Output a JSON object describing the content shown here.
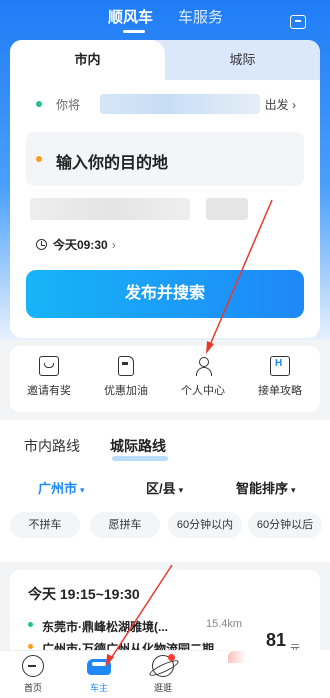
{
  "header": {
    "tabs": [
      {
        "label": "顺风车",
        "active": true
      },
      {
        "label": "车服务",
        "active": false
      }
    ],
    "message_icon": "message-icon"
  },
  "booking": {
    "mode_tabs": [
      {
        "label": "市内",
        "active": true
      },
      {
        "label": "城际",
        "active": false
      }
    ],
    "from_label": "你将",
    "depart_label": "出发 ›",
    "destination_placeholder": "输入你的目的地",
    "time_label": "今天09:30",
    "time_chevron": "›",
    "publish_button": "发布并搜索"
  },
  "quick_actions": [
    {
      "label": "邀请有奖",
      "icon": "gift-card-icon"
    },
    {
      "label": "优惠加油",
      "icon": "fuel-icon"
    },
    {
      "label": "个人中心",
      "icon": "person-icon"
    },
    {
      "label": "接单攻略",
      "icon": "guide-icon"
    }
  ],
  "routes": {
    "tabs": [
      {
        "label": "市内路线",
        "active": false
      },
      {
        "label": "城际路线",
        "active": true
      }
    ],
    "filters": {
      "city": "广州市",
      "district": "区/县",
      "sort": "智能排序"
    },
    "chips": [
      "不拼车",
      "愿拼车",
      "60分钟以内",
      "60分钟以后"
    ]
  },
  "trip": {
    "time": "今天 19:15~19:30",
    "from": "东莞市·鼎峰松湖雅境(...",
    "distance": "15.4km",
    "to": "广州市·万德广州从化物流园二期",
    "price": "81",
    "unit": "元"
  },
  "bottom_nav": [
    {
      "label": "首页",
      "icon": "home-icon",
      "active": false
    },
    {
      "label": "车主",
      "icon": "car-icon",
      "active": true
    },
    {
      "label": "逛逛",
      "icon": "planet-icon",
      "active": false
    }
  ],
  "colors": {
    "accent": "#1e88f8",
    "annotation": "#e8392d"
  }
}
